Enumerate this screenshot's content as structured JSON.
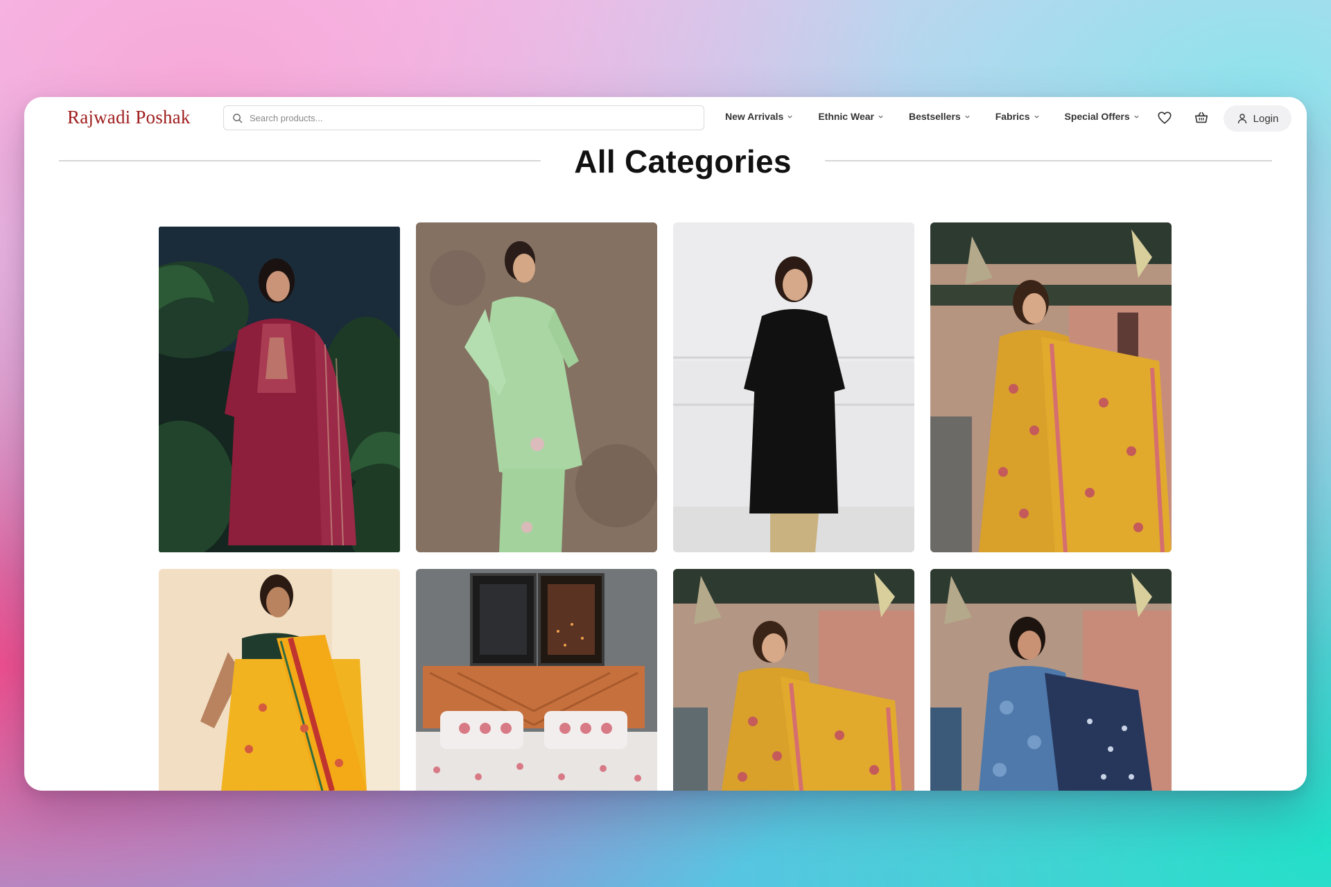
{
  "brand": {
    "name": "Rajwadi Poshak",
    "color": "#9e1b1b"
  },
  "search": {
    "placeholder": "Search products..."
  },
  "nav": [
    {
      "label": "New Arrivals"
    },
    {
      "label": "Ethnic Wear"
    },
    {
      "label": "Bestsellers"
    },
    {
      "label": "Fabrics"
    },
    {
      "label": "Special Offers"
    }
  ],
  "header_icons": [
    "heart-icon",
    "basket-icon",
    "user-icon"
  ],
  "login": {
    "label": "Login"
  },
  "page": {
    "title": "All Categories"
  },
  "categories": [
    {
      "image": "maroon-embroidered-suit"
    },
    {
      "image": "mint-green-kurta-set"
    },
    {
      "image": "black-kurta"
    },
    {
      "image": "mustard-floral-suit-with-dupatta"
    },
    {
      "image": "yellow-saree"
    },
    {
      "image": "floral-bedsheet-set"
    },
    {
      "image": "mustard-floral-anarkali"
    },
    {
      "image": "blue-floral-suit-with-dupatta"
    }
  ]
}
